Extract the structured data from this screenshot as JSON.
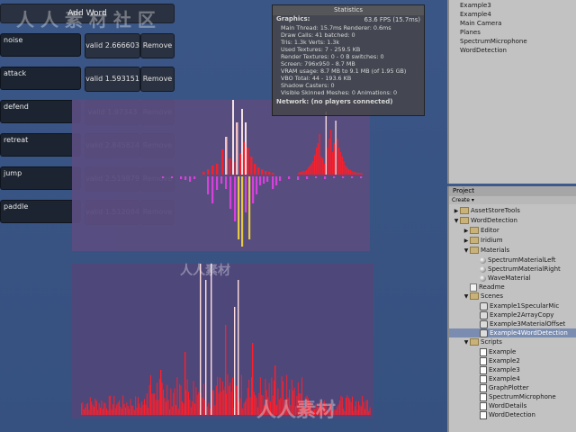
{
  "add_word_label": "Add Word",
  "words": [
    {
      "word": "noise",
      "valid": "valid 2.666603",
      "remove": "Remove",
      "dark": false
    },
    {
      "word": "attack",
      "valid": "valid 1.593151",
      "remove": "Remove",
      "dark": false
    },
    {
      "word": "defend",
      "valid": "valid 1.97343",
      "remove": "Remove",
      "dark": false
    },
    {
      "word": "retreat",
      "valid": "valid 2.845824",
      "remove": "Remove",
      "dark": false
    },
    {
      "word": "jump",
      "valid": "valid 2.519879",
      "remove": "Remove",
      "dark": false
    },
    {
      "word": "paddle",
      "valid": "valid 1.512094",
      "remove": "Remove",
      "dark": true
    }
  ],
  "stats": {
    "title": "Statistics",
    "graphics_label": "Graphics:",
    "fps": "63.6 FPS (15.7ms)",
    "lines": [
      "Main Thread: 15.7ms   Renderer: 0.6ms",
      "Draw Calls: 41    batched: 0",
      "Tris: 1.3k    Verts: 1.3k",
      "Used Textures: 7 - 259.5 KB",
      "Render Textures: 0 - 0 B   switches: 0",
      "Screen: 796x950 - 8.7 MB",
      "VRAM usage: 8.7 MB to 9.1 MB (of 1.95 GB)",
      "VBO Total: 44 - 193.6 KB",
      "Shadow Casters: 0",
      "Visible Skinned Meshes: 0     Animations: 0"
    ],
    "network": "Network: (no players connected)"
  },
  "hierarchy": [
    "Example3",
    "Example4",
    "Main Camera",
    "Planes",
    "SpectrumMicrophone",
    "WordDetection"
  ],
  "project": {
    "tab": "Project",
    "create": "Create",
    "items": [
      {
        "label": "AssetStoreTools",
        "depth": 0,
        "kind": "folder",
        "arrow": "▶"
      },
      {
        "label": "WordDetection",
        "depth": 0,
        "kind": "folder",
        "arrow": "▼"
      },
      {
        "label": "Editor",
        "depth": 1,
        "kind": "folder",
        "arrow": "▶"
      },
      {
        "label": "Iridium",
        "depth": 1,
        "kind": "folder",
        "arrow": "▶"
      },
      {
        "label": "Materials",
        "depth": 1,
        "kind": "folder",
        "arrow": "▼"
      },
      {
        "label": "SpectrumMaterialLeft",
        "depth": 2,
        "kind": "sphere",
        "arrow": ""
      },
      {
        "label": "SpectrumMaterialRight",
        "depth": 2,
        "kind": "sphere",
        "arrow": ""
      },
      {
        "label": "WaveMaterial",
        "depth": 2,
        "kind": "sphere",
        "arrow": ""
      },
      {
        "label": "Readme",
        "depth": 1,
        "kind": "doc",
        "arrow": ""
      },
      {
        "label": "Scenes",
        "depth": 1,
        "kind": "folder",
        "arrow": "▼"
      },
      {
        "label": "Example1SpecularMic",
        "depth": 2,
        "kind": "scene",
        "arrow": ""
      },
      {
        "label": "Example2ArrayCopy",
        "depth": 2,
        "kind": "scene",
        "arrow": ""
      },
      {
        "label": "Example3MaterialOffset",
        "depth": 2,
        "kind": "scene",
        "arrow": ""
      },
      {
        "label": "Example4WordDetection",
        "depth": 2,
        "kind": "scene",
        "arrow": "",
        "selected": true
      },
      {
        "label": "Scripts",
        "depth": 1,
        "kind": "folder",
        "arrow": "▼"
      },
      {
        "label": "Example",
        "depth": 2,
        "kind": "script",
        "arrow": ""
      },
      {
        "label": "Example2",
        "depth": 2,
        "kind": "script",
        "arrow": ""
      },
      {
        "label": "Example3",
        "depth": 2,
        "kind": "script",
        "arrow": ""
      },
      {
        "label": "Example4",
        "depth": 2,
        "kind": "script",
        "arrow": ""
      },
      {
        "label": "GraphPlotter",
        "depth": 2,
        "kind": "script",
        "arrow": ""
      },
      {
        "label": "SpectrumMicrophone",
        "depth": 2,
        "kind": "script",
        "arrow": ""
      },
      {
        "label": "WordDetails",
        "depth": 2,
        "kind": "script",
        "arrow": ""
      },
      {
        "label": "WordDetection",
        "depth": 2,
        "kind": "script",
        "arrow": ""
      }
    ]
  },
  "watermarks": [
    "人 人 素 材 社 区",
    "人人素材",
    "人人素材"
  ],
  "colors": {
    "spectrum_red": "#ff1e2a",
    "spectrum_magenta": "#e040e0",
    "spectrum_yellow": "#f0d040",
    "spectrum_white": "#ffffff"
  }
}
